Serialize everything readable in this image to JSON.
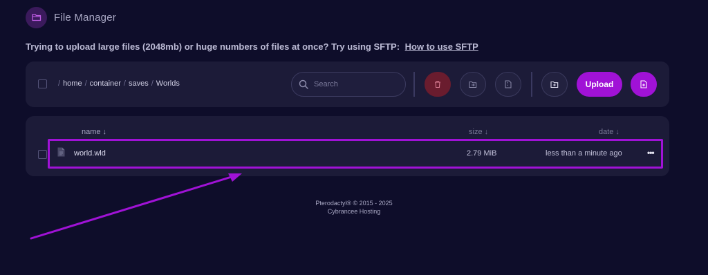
{
  "header": {
    "title": "File Manager",
    "icon": "folder-open-icon"
  },
  "notice": {
    "text": "Trying to upload large files (2048mb) or huge numbers of files at once? Try using SFTP:",
    "link": "How to use SFTP"
  },
  "toolbar": {
    "breadcrumb": [
      "home",
      "container",
      "saves",
      "Worlds"
    ],
    "search_placeholder": "Search",
    "buttons": {
      "delete": "trash-icon",
      "move": "folder-move-icon",
      "archive": "archive-icon",
      "new_folder": "folder-plus-icon",
      "upload_label": "Upload",
      "new_file": "file-plus-icon"
    }
  },
  "table": {
    "columns": {
      "name": "name",
      "size": "size",
      "date": "date"
    },
    "sort_arrow": "↓",
    "rows": [
      {
        "name": "world.wld",
        "size": "2.79 MiB",
        "date": "less than a minute ago",
        "more": "•••"
      }
    ]
  },
  "footer": {
    "line1": "Pterodactyl® © 2015 - 2025",
    "line2": "Cybrancee Hosting"
  },
  "colors": {
    "accent": "#a012d6",
    "background": "#0e0d2a",
    "panel": "#1c1b38",
    "danger": "#6a1c2e"
  }
}
